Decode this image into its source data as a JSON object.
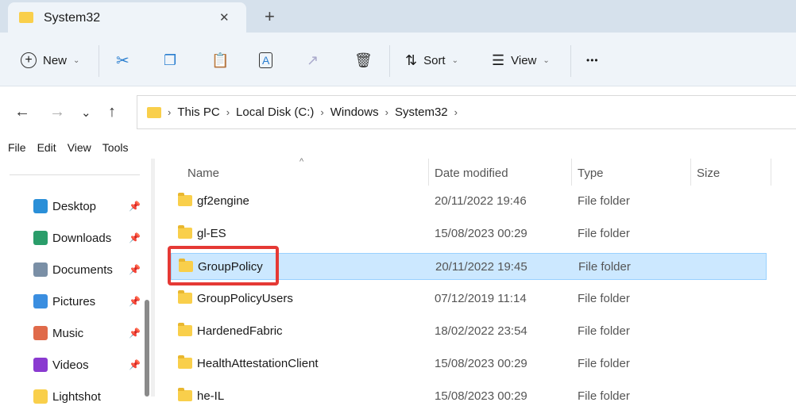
{
  "tab": {
    "title": "System32",
    "close": "✕",
    "new_tab": "+"
  },
  "toolbar": {
    "new_label": "New",
    "sort_label": "Sort",
    "view_label": "View",
    "more": "•••"
  },
  "breadcrumb": [
    "This PC",
    "Local Disk (C:)",
    "Windows",
    "System32"
  ],
  "menubar": [
    "File",
    "Edit",
    "View",
    "Tools"
  ],
  "sidebar": [
    {
      "label": "Desktop",
      "color": "#2a8fd8"
    },
    {
      "label": "Downloads",
      "color": "#2a9d6a"
    },
    {
      "label": "Documents",
      "color": "#7a8fa6"
    },
    {
      "label": "Pictures",
      "color": "#3a8ee0"
    },
    {
      "label": "Music",
      "color": "#e06a4a"
    },
    {
      "label": "Videos",
      "color": "#8a3ad0"
    },
    {
      "label": "Lightshot",
      "color": "#f9cf4b"
    }
  ],
  "columns": {
    "name": "Name",
    "date": "Date modified",
    "type": "Type",
    "size": "Size"
  },
  "rows": [
    {
      "name": "gf2engine",
      "date": "20/11/2022 19:46",
      "type": "File folder"
    },
    {
      "name": "gl-ES",
      "date": "15/08/2023 00:29",
      "type": "File folder"
    },
    {
      "name": "GroupPolicy",
      "date": "20/11/2022 19:45",
      "type": "File folder"
    },
    {
      "name": "GroupPolicyUsers",
      "date": "07/12/2019 11:14",
      "type": "File folder"
    },
    {
      "name": "HardenedFabric",
      "date": "18/02/2022 23:54",
      "type": "File folder"
    },
    {
      "name": "HealthAttestationClient",
      "date": "15/08/2023 00:29",
      "type": "File folder"
    },
    {
      "name": "he-IL",
      "date": "15/08/2023 00:29",
      "type": "File folder"
    }
  ]
}
